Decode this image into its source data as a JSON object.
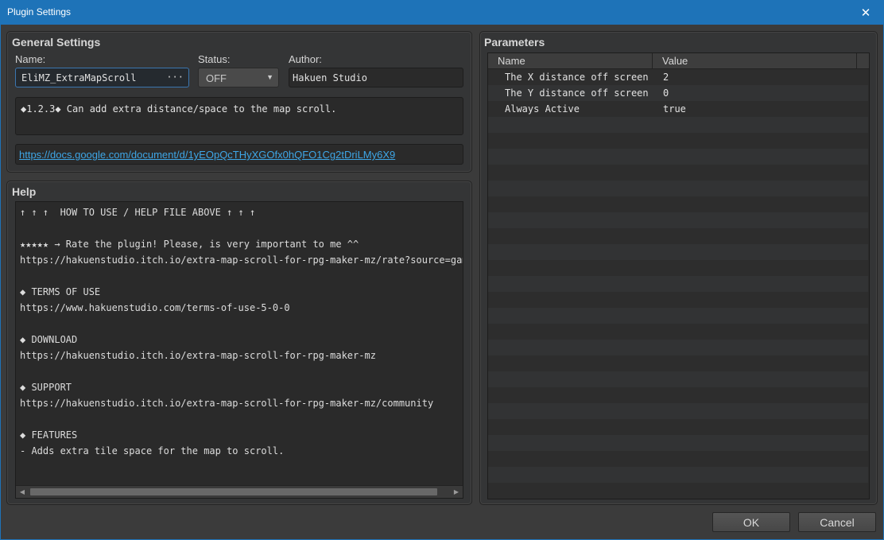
{
  "window": {
    "title": "Plugin Settings",
    "close_glyph": "✕"
  },
  "general": {
    "title": "General Settings",
    "name_label": "Name:",
    "name_value": "EliMZ_ExtraMapScroll",
    "name_browse": "···",
    "status_label": "Status:",
    "status_value": "OFF",
    "author_label": "Author:",
    "author_value": "Hakuen Studio",
    "description": "◆1.2.3◆ Can add extra distance/space to the map scroll.",
    "url": "https://docs.google.com/document/d/1yEOpQcTHyXGOfx0hQFO1Cg2tDriLMy6X9"
  },
  "help": {
    "title": "Help",
    "lines": [
      "↑ ↑ ↑  HOW TO USE / HELP FILE ABOVE ↑ ↑ ↑",
      "",
      "★★★★★ → Rate the plugin! Please, is very important to me ^^",
      "https://hakuenstudio.itch.io/extra-map-scroll-for-rpg-maker-mz/rate?source=game",
      "",
      "◆ TERMS OF USE",
      "https://www.hakuenstudio.com/terms-of-use-5-0-0",
      "",
      "◆ DOWNLOAD",
      "https://hakuenstudio.itch.io/extra-map-scroll-for-rpg-maker-mz",
      "",
      "◆ SUPPORT",
      "https://hakuenstudio.itch.io/extra-map-scroll-for-rpg-maker-mz/community",
      "",
      "◆ FEATURES",
      "- Adds extra tile space for the map to scroll."
    ]
  },
  "parameters": {
    "title": "Parameters",
    "columns": [
      "Name",
      "Value"
    ],
    "rows": [
      {
        "name": "The X distance off screen",
        "value": "2"
      },
      {
        "name": "The Y distance off screen",
        "value": "0"
      },
      {
        "name": "Always Active",
        "value": "true"
      }
    ]
  },
  "buttons": {
    "ok": "OK",
    "cancel": "Cancel"
  },
  "colors": {
    "titlebar": "#1e73b8",
    "link": "#3ea6e6",
    "background": "#3b3b3b"
  }
}
